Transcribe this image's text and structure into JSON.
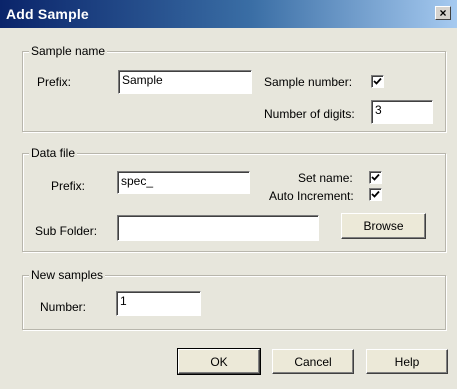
{
  "window": {
    "title": "Add Sample",
    "close_glyph": "×"
  },
  "sample_name": {
    "legend": "Sample name",
    "prefix_label": "Prefix:",
    "prefix_value": "Sample",
    "sample_number_label": "Sample number:",
    "sample_number_checked": true,
    "digits_label": "Number of digits:",
    "digits_value": "3"
  },
  "data_file": {
    "legend": "Data file",
    "prefix_label": "Prefix:",
    "prefix_value": "spec_",
    "set_name_label": "Set name:",
    "set_name_checked": true,
    "auto_increment_label": "Auto Increment:",
    "auto_increment_checked": true,
    "subfolder_label": "Sub Folder:",
    "subfolder_value": "",
    "browse_label": "Browse"
  },
  "new_samples": {
    "legend": "New samples",
    "number_label": "Number:",
    "number_value": "1"
  },
  "buttons": {
    "ok": "OK",
    "cancel": "Cancel",
    "help": "Help"
  }
}
